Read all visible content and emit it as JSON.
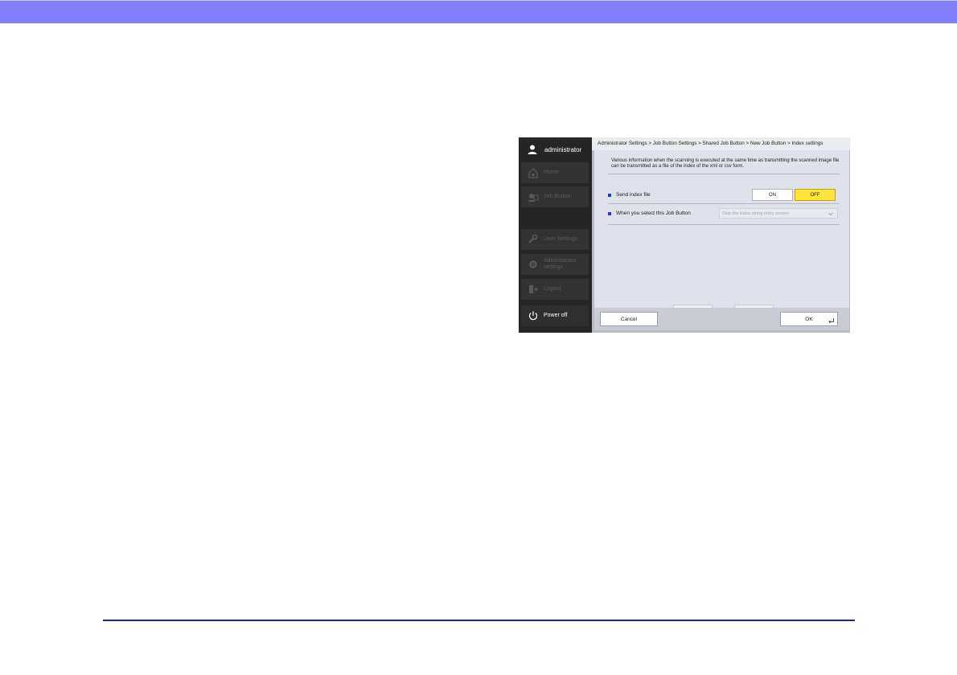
{
  "device": {
    "user": {
      "name": "administrator",
      "icon": "person-icon"
    },
    "nav": [
      {
        "label": "Home",
        "icon": "home-icon",
        "enabled": false
      },
      {
        "label": "Job Button",
        "icon": "job-button-icon",
        "enabled": false
      },
      {
        "label": "User Settings",
        "icon": "wrench-icon",
        "enabled": false
      },
      {
        "label": "Administrator settings",
        "icon": "gear-icon",
        "enabled": false
      },
      {
        "label": "Logout",
        "icon": "logout-icon",
        "enabled": false
      },
      {
        "label": "Power off",
        "icon": "power-icon",
        "enabled": true
      }
    ],
    "breadcrumb": "Administrator Settings > Job Button Settings > Shared Job Button > New Job Button > Index settings",
    "description": "Various information when the scanning is executed at the same time as transmitting the scanned image file can be transmitted as a file of the index of the xml or csv form.",
    "send_index": {
      "label": "Send index file",
      "on_label": "ON",
      "off_label": "OFF",
      "selected": "OFF"
    },
    "when_select": {
      "label": "When you select this Job Button",
      "value": "Skip the index string entry screen"
    },
    "footer": {
      "cancel_label": "Cancel",
      "ok_label": "OK"
    },
    "colors": {
      "top_band": "#8080ff",
      "bottom_rule": "#1f1fb4",
      "selected_toggle": "#ffe53b",
      "bullet": "#1f3fbf"
    }
  }
}
